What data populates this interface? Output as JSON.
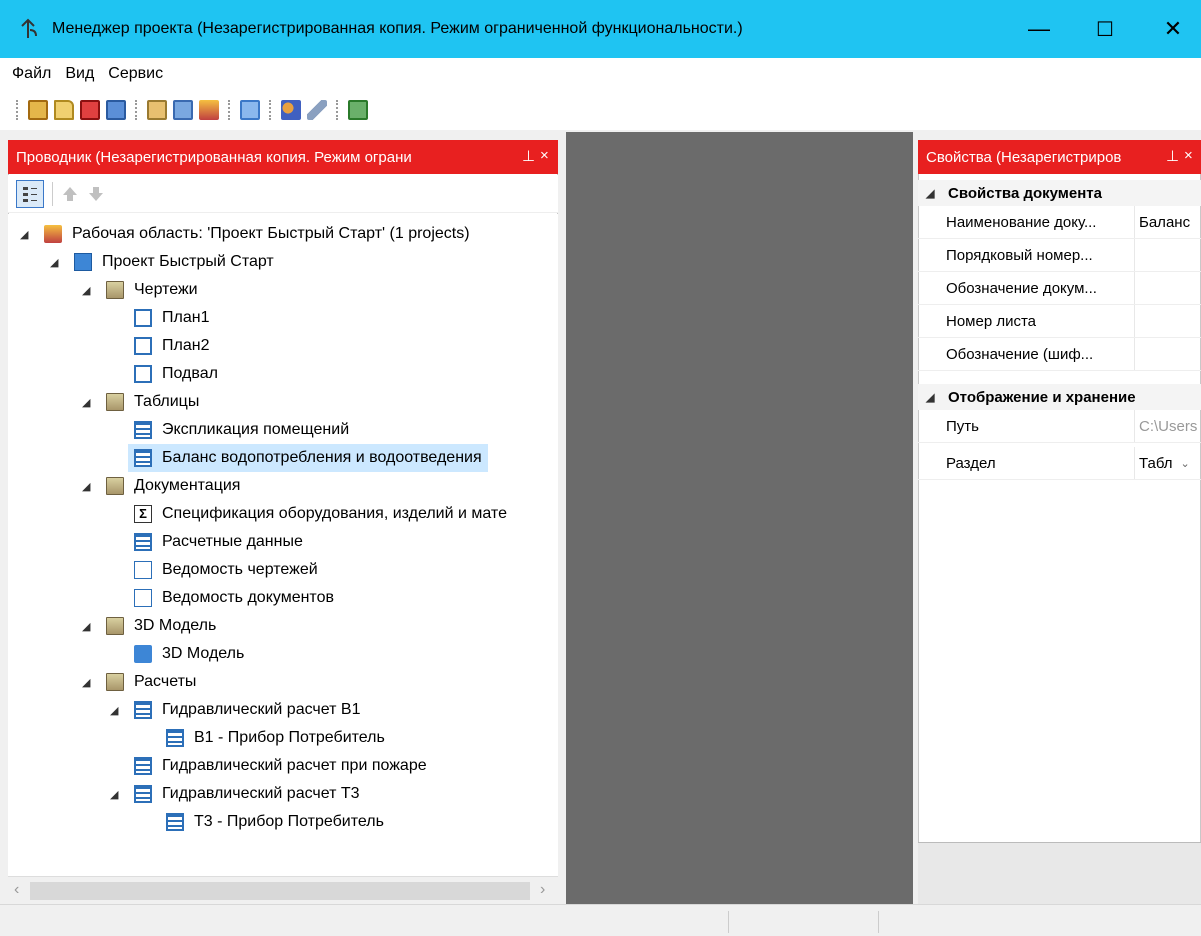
{
  "window": {
    "title": "Менеджер проекта (Незарегистрированная копия. Режим ограниченной функциональности.)",
    "minimize": "—",
    "maximize": "☐",
    "close": "✕",
    "title_bar_color": "#1fc4f2"
  },
  "menu": {
    "file": "Файл",
    "view": "Вид",
    "service": "Сервис"
  },
  "toolbar": {
    "icons": [
      "new-project-icon",
      "open-icon",
      "close-project-icon",
      "save-icon",
      "properties-icon",
      "add-document-icon",
      "workspace-icon",
      "layout-icon",
      "users-icon",
      "settings-wrench-icon",
      "export-icon"
    ]
  },
  "explorer": {
    "header": "Проводник (Незарегистрированная копия. Режим ограни",
    "pin": "⊥",
    "close": "×",
    "header_color": "#e82020",
    "tree": {
      "workspace": "Рабочая область: 'Проект Быстрый Старт' (1 projects)",
      "project": "Проект Быстрый Старт",
      "drawings": "Чертежи",
      "plan1": "План1",
      "plan2": "План2",
      "basement": "Подвал",
      "tables": "Таблицы",
      "room_explication": "Экспликация помещений",
      "balance": "Баланс водопотребления и водоотведения",
      "documentation": "Документация",
      "specification": "Спецификация оборудования, изделий и мате",
      "calc_data": "Расчетные данные",
      "drawing_list": "Ведомость чертежей",
      "document_list": "Ведомость документов",
      "model_folder": "3D Модель",
      "model": "3D Модель",
      "calculations": "Расчеты",
      "hydro_b1": "Гидравлический расчет В1",
      "b1_device": "В1 - Прибор Потребитель",
      "hydro_fire": "Гидравлический расчет при пожаре",
      "hydro_t3": "Гидравлический расчет Т3",
      "t3_device": "Т3 - Прибор Потребитель"
    },
    "scroll_left": "‹",
    "scroll_right": "›"
  },
  "properties": {
    "header": "Свойства (Незарегистриров",
    "pin": "⊥",
    "close": "×",
    "cat_document": "Свойства документа",
    "doc_name_label": "Наименование доку...",
    "doc_name_value": "Баланс",
    "ordinal_label": "Порядковый номер...",
    "designation_label": "Обозначение докум...",
    "sheet_label": "Номер листа",
    "cipher_label": "Обозначение (шиф...",
    "cat_display": "Отображение и хранение",
    "path_label": "Путь",
    "path_value": "C:\\Users",
    "section_label": "Раздел",
    "section_value": "Табл"
  }
}
